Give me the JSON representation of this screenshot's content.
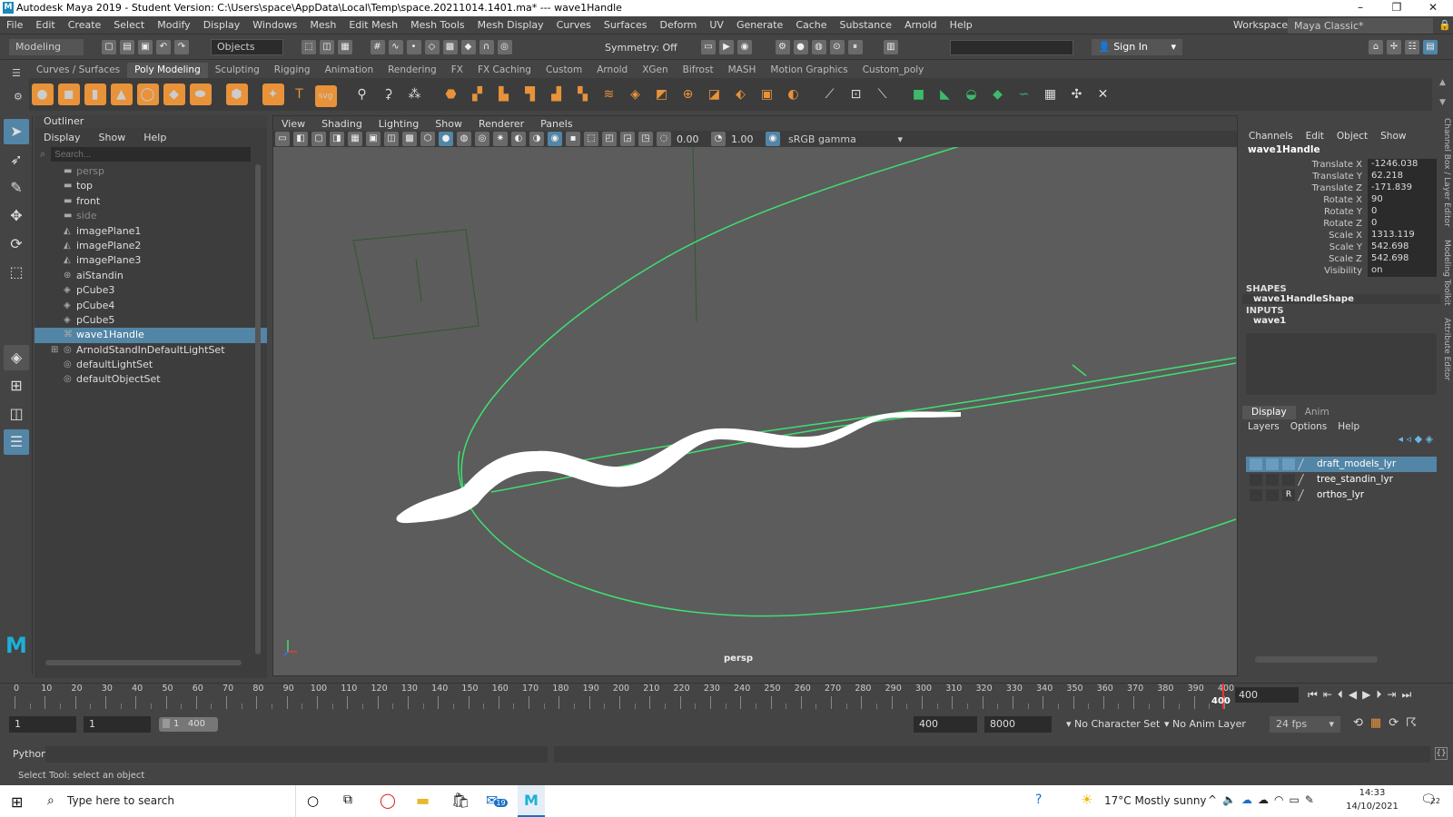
{
  "window": {
    "title": "Autodesk Maya 2019 - Student Version: C:\\Users\\space\\AppData\\Local\\Temp\\space.20211014.1401.ma*  ---  wave1Handle"
  },
  "menus": [
    "File",
    "Edit",
    "Create",
    "Select",
    "Modify",
    "Display",
    "Windows",
    "Mesh",
    "Edit Mesh",
    "Mesh Tools",
    "Mesh Display",
    "Curves",
    "Surfaces",
    "Deform",
    "UV",
    "Generate",
    "Cache",
    "Substance",
    "Arnold",
    "Help"
  ],
  "workspace": {
    "label": "Workspace :",
    "value": "Maya Classic*"
  },
  "status": {
    "mode": "Modeling",
    "select_mode": "Objects",
    "symmetry": "Symmetry: Off",
    "sign_in": "Sign In"
  },
  "shelf_tabs": [
    "Curves / Surfaces",
    "Poly Modeling",
    "Sculpting",
    "Rigging",
    "Animation",
    "Rendering",
    "FX",
    "FX Caching",
    "Custom",
    "Arnold",
    "XGen",
    "Bifrost",
    "MASH",
    "Motion Graphics",
    "Custom_poly"
  ],
  "shelf_active": "Poly Modeling",
  "outliner": {
    "title": "Outliner",
    "menu": [
      "Display",
      "Show",
      "Help"
    ],
    "search_placeholder": "Search...",
    "items": [
      {
        "name": "persp",
        "icon": "camera-icon",
        "dim": true
      },
      {
        "name": "top",
        "icon": "camera-icon"
      },
      {
        "name": "front",
        "icon": "camera-icon"
      },
      {
        "name": "side",
        "icon": "camera-icon",
        "dim": true
      },
      {
        "name": "imagePlane1",
        "icon": "image-plane-icon"
      },
      {
        "name": "imagePlane2",
        "icon": "image-plane-icon"
      },
      {
        "name": "imagePlane3",
        "icon": "image-plane-icon"
      },
      {
        "name": "aiStandin",
        "icon": "standin-icon"
      },
      {
        "name": "pCube3",
        "icon": "transform-icon"
      },
      {
        "name": "pCube4",
        "icon": "transform-icon"
      },
      {
        "name": "pCube5",
        "icon": "transform-icon"
      },
      {
        "name": "wave1Handle",
        "icon": "deformer-handle-icon",
        "selected": true
      },
      {
        "name": "ArnoldStandInDefaultLightSet",
        "icon": "set-icon",
        "expandable": true
      },
      {
        "name": "defaultLightSet",
        "icon": "set-icon"
      },
      {
        "name": "defaultObjectSet",
        "icon": "set-icon"
      }
    ]
  },
  "viewport": {
    "menu": [
      "View",
      "Shading",
      "Lighting",
      "Show",
      "Renderer",
      "Panels"
    ],
    "exposure": "0.00",
    "gamma": "1.00",
    "color_space": "sRGB gamma",
    "camera_label": "persp"
  },
  "channel_box": {
    "menu": [
      "Channels",
      "Edit",
      "Object",
      "Show"
    ],
    "object": "wave1Handle",
    "channels": [
      {
        "name": "Translate X",
        "value": "-1246.038"
      },
      {
        "name": "Translate Y",
        "value": "62.218"
      },
      {
        "name": "Translate Z",
        "value": "-171.839"
      },
      {
        "name": "Rotate X",
        "value": "90"
      },
      {
        "name": "Rotate Y",
        "value": "0"
      },
      {
        "name": "Rotate Z",
        "value": "0"
      },
      {
        "name": "Scale X",
        "value": "1313.119"
      },
      {
        "name": "Scale Y",
        "value": "542.698"
      },
      {
        "name": "Scale Z",
        "value": "542.698"
      },
      {
        "name": "Visibility",
        "value": "on"
      }
    ],
    "shapes_header": "SHAPES",
    "shape": "wave1HandleShape",
    "inputs_header": "INPUTS",
    "input": "wave1",
    "side_tabs": [
      "Channel Box / Layer Editor",
      "Modeling Toolkit",
      "Attribute Editor"
    ]
  },
  "layer_editor": {
    "tabs": [
      "Display",
      "Anim"
    ],
    "menu": [
      "Layers",
      "Options",
      "Help"
    ],
    "layers": [
      {
        "name": "draft_models_lyr",
        "selected": true,
        "flag": ""
      },
      {
        "name": "tree_standin_lyr",
        "flag": ""
      },
      {
        "name": "orthos_lyr",
        "flag": "R"
      }
    ]
  },
  "timeline": {
    "ticks": [
      "0",
      "10",
      "20",
      "30",
      "40",
      "50",
      "60",
      "70",
      "80",
      "90",
      "100",
      "110",
      "120",
      "130",
      "140",
      "150",
      "160",
      "170",
      "180",
      "190",
      "200",
      "210",
      "220",
      "230",
      "240",
      "250",
      "260",
      "270",
      "280",
      "290",
      "300",
      "310",
      "320",
      "330",
      "340",
      "350",
      "360",
      "370",
      "380",
      "390",
      "400"
    ],
    "current_frame": "400",
    "end_field": "400"
  },
  "range": {
    "start": "1",
    "current": "1",
    "slider_start": "1",
    "slider_end": "400",
    "end": "400",
    "max": "8000",
    "character_set": "No Character Set",
    "anim_layer": "No Anim Layer",
    "fps": "24 fps"
  },
  "command_line": {
    "language": "Python"
  },
  "help_line": "Select Tool: select an object",
  "taskbar": {
    "search": "Type here to search",
    "weather": "17°C  Mostly sunny",
    "time": "14:33",
    "date": "14/10/2021",
    "mail_badge": "19",
    "notif_badge": "22"
  }
}
